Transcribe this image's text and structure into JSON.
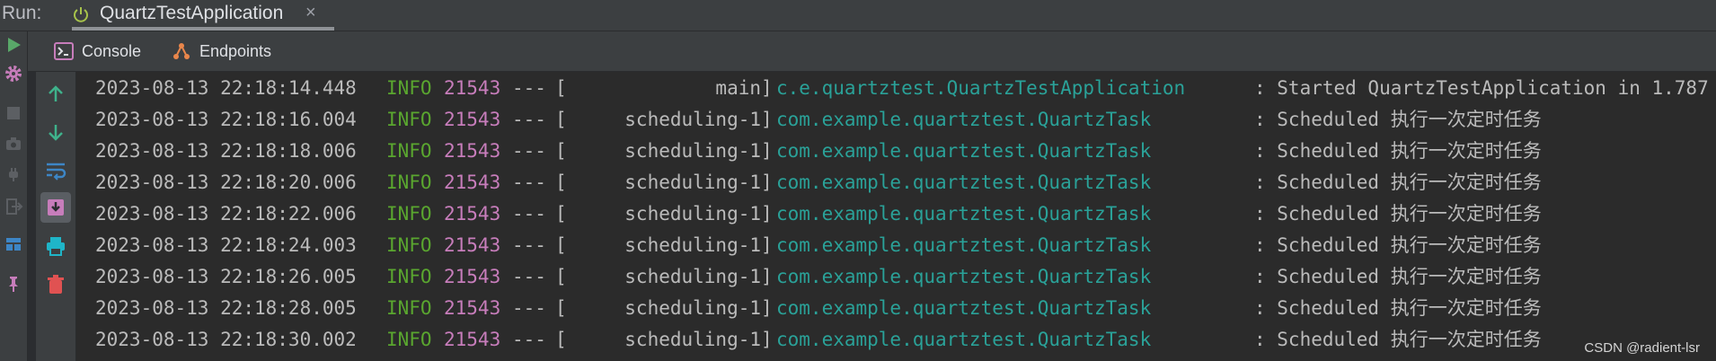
{
  "run_bar": {
    "label": "Run:",
    "tab_title": "QuartzTestApplication",
    "tab_icon": "power-icon",
    "close_glyph": "×"
  },
  "outer_toolbar": {
    "icons": [
      "rerun-icon",
      "settings-icon",
      "stop-icon",
      "camera-icon",
      "plug-icon",
      "exit-icon",
      "layout-icon",
      "pin-icon"
    ]
  },
  "subtabs": [
    {
      "label": "Console",
      "icon": "console-icon"
    },
    {
      "label": "Endpoints",
      "icon": "endpoints-icon"
    }
  ],
  "inner_toolbar": {
    "icons": [
      "up-arrow-icon",
      "down-arrow-icon",
      "soft-wrap-icon",
      "scroll-to-end-icon",
      "print-icon",
      "trash-icon"
    ]
  },
  "log_lines": [
    {
      "timestamp": "2023-08-13 22:18:14.448",
      "level": "INFO",
      "pid": "21543",
      "sep": "---",
      "thread": "main",
      "logger": "c.e.quartztest.QuartzTestApplication",
      "message": ": Started QuartzTestApplication in 1.787"
    },
    {
      "timestamp": "2023-08-13 22:18:16.004",
      "level": "INFO",
      "pid": "21543",
      "sep": "---",
      "thread": "scheduling-1",
      "logger": "com.example.quartztest.QuartzTask",
      "message": ": Scheduled 执行一次定时任务"
    },
    {
      "timestamp": "2023-08-13 22:18:18.006",
      "level": "INFO",
      "pid": "21543",
      "sep": "---",
      "thread": "scheduling-1",
      "logger": "com.example.quartztest.QuartzTask",
      "message": ": Scheduled 执行一次定时任务"
    },
    {
      "timestamp": "2023-08-13 22:18:20.006",
      "level": "INFO",
      "pid": "21543",
      "sep": "---",
      "thread": "scheduling-1",
      "logger": "com.example.quartztest.QuartzTask",
      "message": ": Scheduled 执行一次定时任务"
    },
    {
      "timestamp": "2023-08-13 22:18:22.006",
      "level": "INFO",
      "pid": "21543",
      "sep": "---",
      "thread": "scheduling-1",
      "logger": "com.example.quartztest.QuartzTask",
      "message": ": Scheduled 执行一次定时任务"
    },
    {
      "timestamp": "2023-08-13 22:18:24.003",
      "level": "INFO",
      "pid": "21543",
      "sep": "---",
      "thread": "scheduling-1",
      "logger": "com.example.quartztest.QuartzTask",
      "message": ": Scheduled 执行一次定时任务"
    },
    {
      "timestamp": "2023-08-13 22:18:26.005",
      "level": "INFO",
      "pid": "21543",
      "sep": "---",
      "thread": "scheduling-1",
      "logger": "com.example.quartztest.QuartzTask",
      "message": ": Scheduled 执行一次定时任务"
    },
    {
      "timestamp": "2023-08-13 22:18:28.005",
      "level": "INFO",
      "pid": "21543",
      "sep": "---",
      "thread": "scheduling-1",
      "logger": "com.example.quartztest.QuartzTask",
      "message": ": Scheduled 执行一次定时任务"
    },
    {
      "timestamp": "2023-08-13 22:18:30.002",
      "level": "INFO",
      "pid": "21543",
      "sep": "---",
      "thread": "scheduling-1",
      "logger": "com.example.quartztest.QuartzTask",
      "message": ": Scheduled 执行一次定时任务"
    }
  ],
  "watermark": "CSDN @radient-lsr",
  "colors": {
    "info": "#5aa62f",
    "pid": "#c77dbb",
    "logger": "#2aa198",
    "rerun": "#59a869",
    "settings": "#c77dbb",
    "scroll_nav": "#3fb28b"
  }
}
